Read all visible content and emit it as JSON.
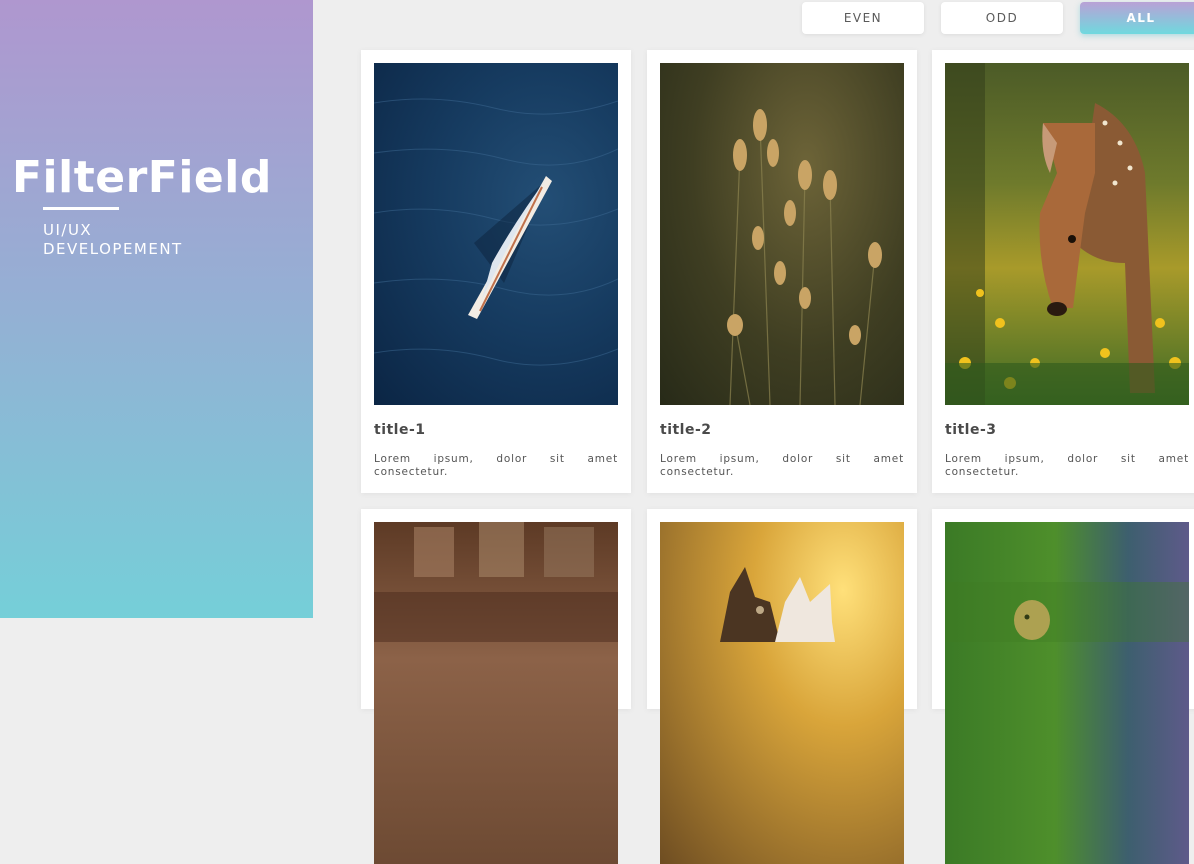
{
  "sidebar": {
    "brand": "FilterField",
    "tagline_line1": "UI/UX",
    "tagline_line2": "DEVELOPEMENT"
  },
  "filters": [
    {
      "label": "EVEN",
      "active": false
    },
    {
      "label": "ODD",
      "active": false
    },
    {
      "label": "ALL",
      "active": true
    }
  ],
  "cards": [
    {
      "title": "title-1",
      "desc": "Lorem ipsum, dolor sit amet consectetur.",
      "image": "sailboat-aerial"
    },
    {
      "title": "title-2",
      "desc": "Lorem ipsum, dolor sit amet consectetur.",
      "image": "grass-seedheads"
    },
    {
      "title": "title-3",
      "desc": "Lorem ipsum, dolor sit amet consectetur.",
      "image": "fawn-in-flowers"
    },
    {
      "title": "",
      "desc": "",
      "image": "blurred-building"
    },
    {
      "title": "",
      "desc": "",
      "image": "kittens-sunlight"
    },
    {
      "title": "",
      "desc": "",
      "image": "duckling-grass"
    }
  ],
  "colors": {
    "sidebar_top": "#af97cf",
    "sidebar_bottom": "#75cfd8",
    "page_bg": "#eeeeee",
    "active_filter_top": "#b9a1d6",
    "active_filter_bottom": "#6fd9de"
  }
}
